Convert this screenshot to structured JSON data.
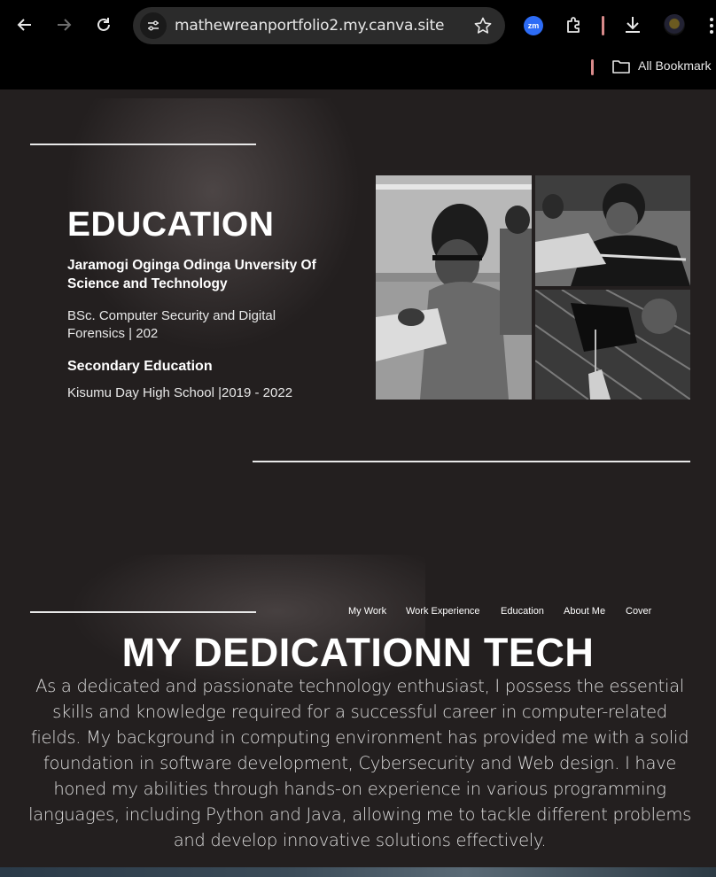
{
  "browser": {
    "url": "mathewreanportfolio2.my.canva.site",
    "extension_badge": "zm",
    "bookmarks_label": "All Bookmark"
  },
  "education": {
    "title": "EDUCATION",
    "university": "Jaramogi Oginga Odinga Unversity Of Science and Technology",
    "degree": "BSc. Computer Security and Digital Forensics | 202",
    "secondary_title": "Secondary Education",
    "secondary_school": "Kisumu Day High School |2019 - 2022"
  },
  "nav": {
    "items": [
      "My Work",
      "Work Experience",
      "Education",
      "About Me",
      "Cover"
    ]
  },
  "dedication": {
    "title": "MY DEDICATIONN TECH",
    "paragraph": "As a dedicated and passionate technology enthusiast, I possess the essential skills and knowledge required for a successful career in computer-related fields. My background in computing environment has provided me with a solid foundation in software development, Cybersecurity and Web design. I have honed my abilities through hands-on experience in various programming languages, including Python and Java, allowing me to tackle different problems and develop innovative solutions effectively."
  },
  "colors": {
    "page_bg": "#231f1f",
    "chrome_bg": "#000000",
    "accent_blue": "#2d6cf6"
  }
}
